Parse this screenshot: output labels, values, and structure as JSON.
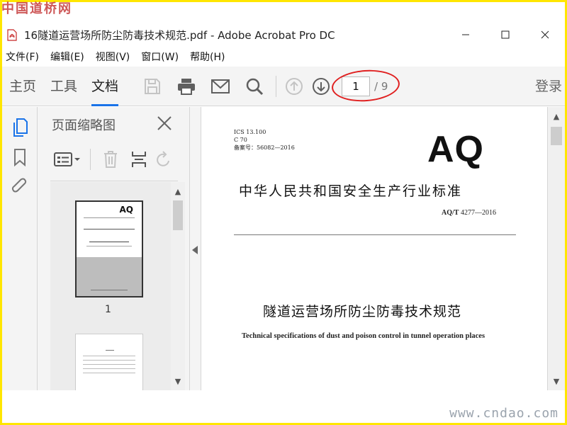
{
  "watermark": {
    "top": "中国道桥网",
    "bottom": "www.cndao.com"
  },
  "window": {
    "title": "16隧道运营场所防尘防毒技术规范.pdf - Adobe Acrobat Pro DC",
    "minimize": "—",
    "maximize": "☐",
    "close": "✕"
  },
  "menu": [
    "文件(F)",
    "编辑(E)",
    "视图(V)",
    "窗口(W)",
    "帮助(H)"
  ],
  "toolbar": {
    "tabs": [
      "主页",
      "工具",
      "文档"
    ],
    "active_tab": "文档",
    "page_current": "1",
    "page_total": "/ 9",
    "login": "登录"
  },
  "panel": {
    "title": "页面缩略图",
    "thumb_page": "1"
  },
  "document": {
    "meta_lines": [
      "ICS 13.100",
      "C 70",
      "备案号：56082—2016"
    ],
    "badge": "AQ",
    "heading": "中华人民共和国安全生产行业标准",
    "std_prefix": "AQ/T",
    "std_number": "4277—2016",
    "title": "隧道运营场所防尘防毒技术规范",
    "subtitle": "Technical specifications of dust and poison control in tunnel operation places"
  },
  "colors": {
    "accent": "#1a73e8",
    "highlight": "#e02020",
    "frame": "#ffe600"
  },
  "icons": [
    "pdf-file-icon",
    "save-icon",
    "print-icon",
    "mail-icon",
    "search-icon",
    "page-up-icon",
    "page-down-icon",
    "pages-icon",
    "bookmark-icon",
    "attachment-icon",
    "close-icon",
    "options-icon",
    "delete-icon",
    "insert-icon",
    "rotate-icon"
  ]
}
